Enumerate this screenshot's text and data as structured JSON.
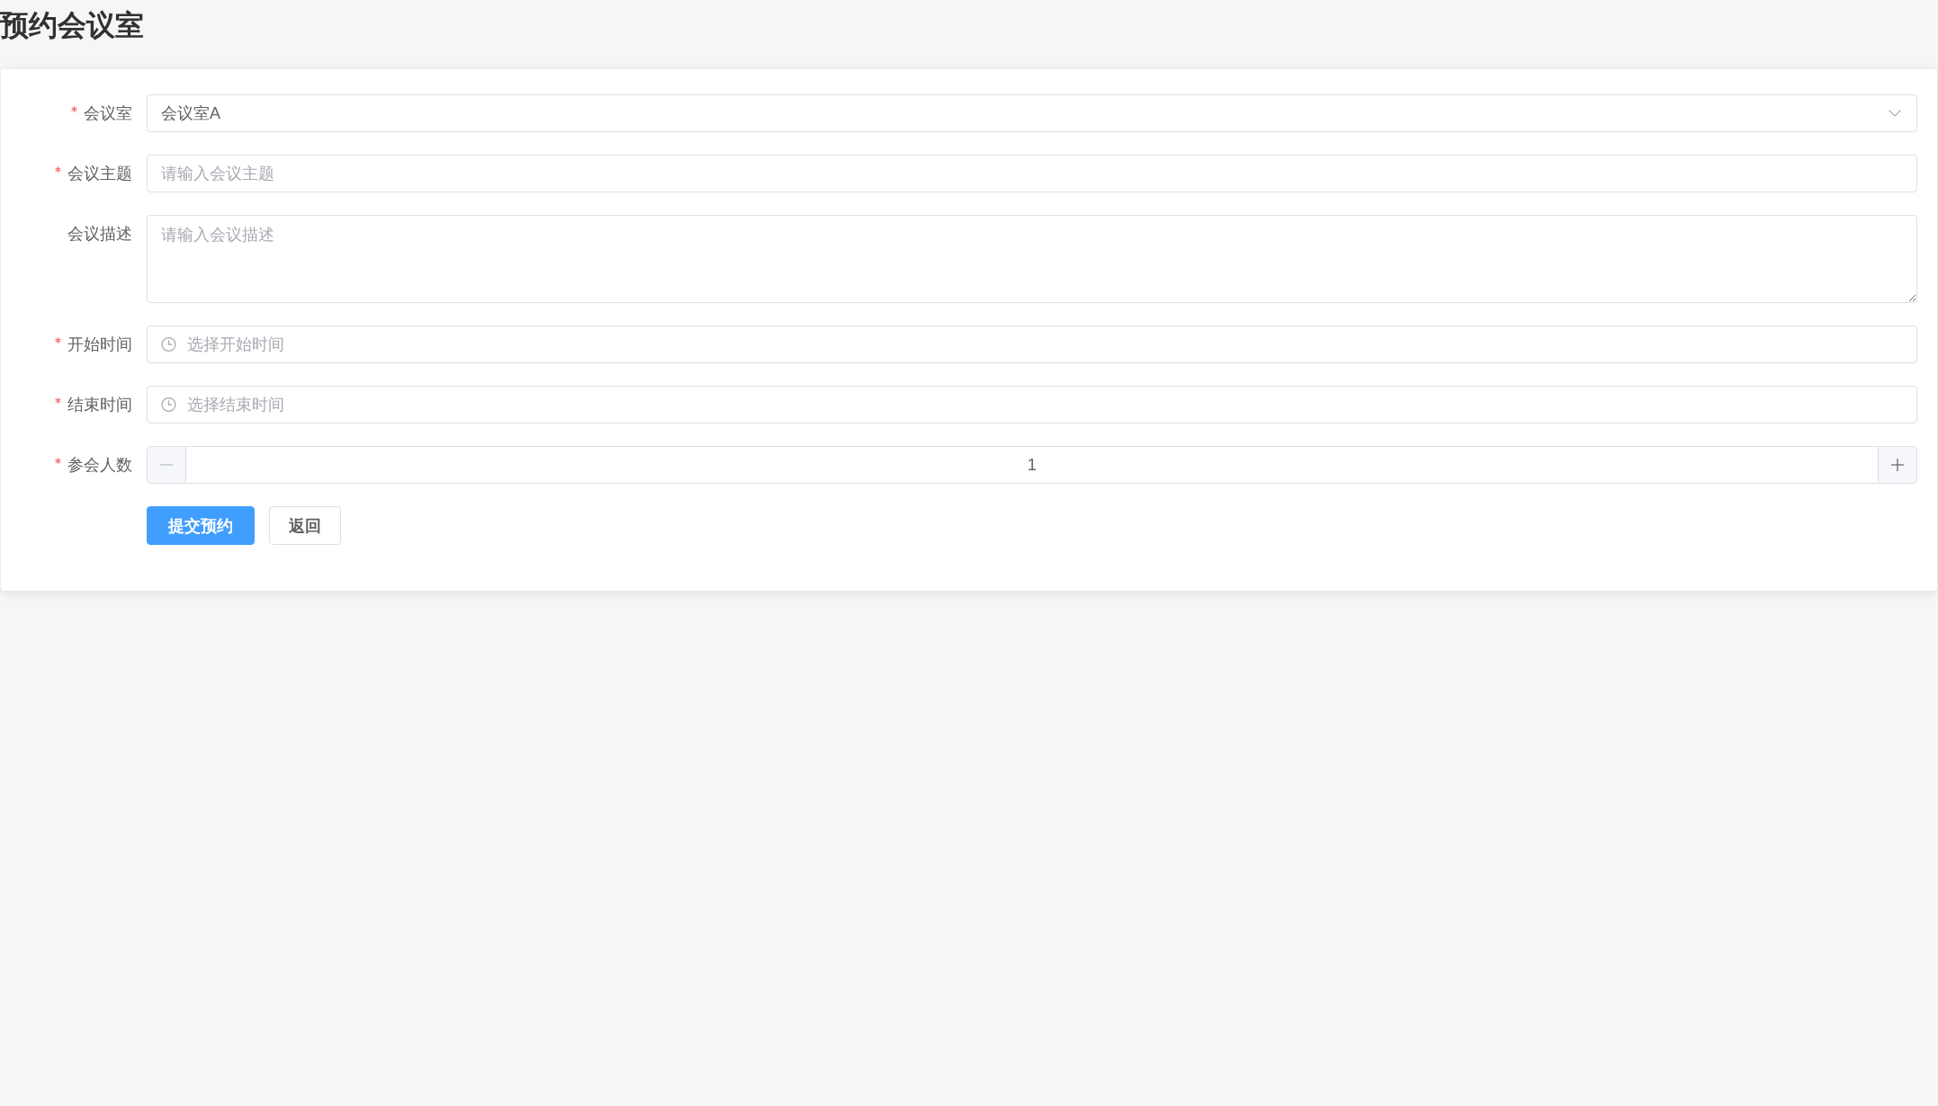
{
  "page": {
    "title": "预约会议室"
  },
  "form": {
    "fields": [
      {
        "kind": "select",
        "label": "会议室",
        "required": true,
        "value": "会议室A"
      },
      {
        "kind": "text",
        "label": "会议主题",
        "required": true,
        "placeholder": "请输入会议主题"
      },
      {
        "kind": "textarea",
        "label": "会议描述",
        "required": false,
        "placeholder": "请输入会议描述"
      },
      {
        "kind": "time",
        "label": "开始时间",
        "required": true,
        "placeholder": "选择开始时间"
      },
      {
        "kind": "time",
        "label": "结束时间",
        "required": true,
        "placeholder": "选择结束时间"
      },
      {
        "kind": "number",
        "label": "参会人数",
        "required": true,
        "value": "1",
        "decrease_disabled": true
      }
    ],
    "buttons": [
      {
        "kind": "primary",
        "label": "提交预约"
      },
      {
        "kind": "default",
        "label": "返回"
      }
    ]
  }
}
